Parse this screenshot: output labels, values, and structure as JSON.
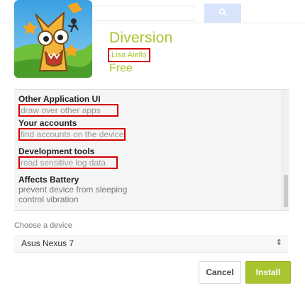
{
  "search": {
    "button_icon": "search-icon"
  },
  "app": {
    "title": "Diversion",
    "developer": "Lisa Aiello",
    "price": "Free",
    "icon": "diversion-app-icon",
    "accent": "#a8c42f"
  },
  "permissions": [
    {
      "heading": "Other Application UI",
      "items": [
        "draw over other apps"
      ],
      "highlighted": true
    },
    {
      "heading": "Your accounts",
      "items": [
        "find accounts on the device"
      ],
      "highlighted": true
    },
    {
      "heading": "Development tools",
      "items": [
        "read sensitive log data"
      ],
      "highlighted": true
    },
    {
      "heading": "Affects Battery",
      "items": [
        "prevent device from sleeping",
        "control vibration"
      ],
      "highlighted": false
    }
  ],
  "device": {
    "label": "Choose a device",
    "selected": "Asus Nexus 7"
  },
  "buttons": {
    "cancel": "Cancel",
    "install": "Install"
  },
  "highlight_color": "#d50000"
}
